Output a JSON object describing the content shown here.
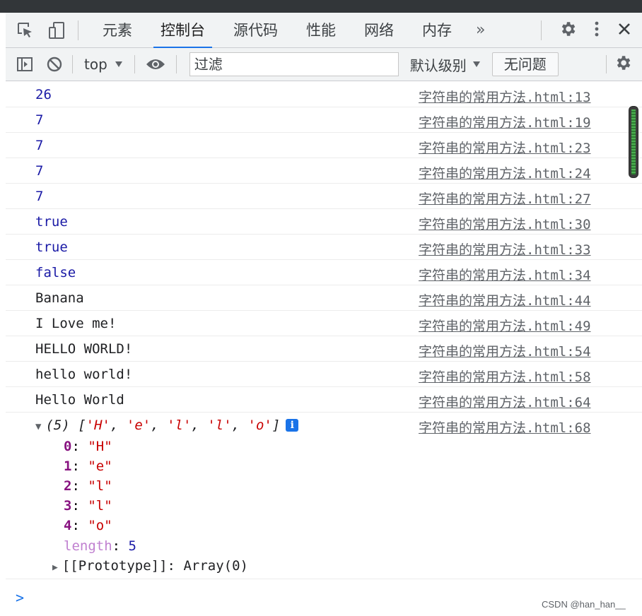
{
  "tabs": [
    {
      "label": "元素"
    },
    {
      "label": "控制台",
      "active": true
    },
    {
      "label": "源代码"
    },
    {
      "label": "性能"
    },
    {
      "label": "网络"
    },
    {
      "label": "内存"
    }
  ],
  "more_tabs_glyph": "»",
  "toolbar": {
    "context": "top",
    "filter_placeholder": "过滤",
    "levels_label": "默认级别",
    "issues_label": "无问题"
  },
  "console": {
    "rows": [
      {
        "text": "26",
        "type": "num",
        "source": "字符串的常用方法.html:13"
      },
      {
        "text": "7",
        "type": "num",
        "source": "字符串的常用方法.html:19"
      },
      {
        "text": "7",
        "type": "num",
        "source": "字符串的常用方法.html:23"
      },
      {
        "text": "7",
        "type": "num",
        "source": "字符串的常用方法.html:24"
      },
      {
        "text": "7",
        "type": "num",
        "source": "字符串的常用方法.html:27"
      },
      {
        "text": "true",
        "type": "bool",
        "source": "字符串的常用方法.html:30"
      },
      {
        "text": "true",
        "type": "bool",
        "source": "字符串的常用方法.html:33"
      },
      {
        "text": "false",
        "type": "bool",
        "source": "字符串的常用方法.html:34"
      },
      {
        "text": "Banana",
        "type": "str",
        "source": "字符串的常用方法.html:44"
      },
      {
        "text": "I Love me!",
        "type": "str",
        "source": "字符串的常用方法.html:49"
      },
      {
        "text": "HELLO WORLD!",
        "type": "str",
        "source": "字符串的常用方法.html:54"
      },
      {
        "text": "hello world!",
        "type": "str",
        "source": "字符串的常用方法.html:58"
      },
      {
        "text": "Hello World",
        "type": "str",
        "source": "字符串的常用方法.html:64"
      }
    ],
    "array_entry": {
      "count": "(5)",
      "items": [
        "'H'",
        "'e'",
        "'l'",
        "'l'",
        "'o'"
      ],
      "source": "字符串的常用方法.html:68",
      "info": "i",
      "props": [
        {
          "key": "0",
          "value": "\"H\""
        },
        {
          "key": "1",
          "value": "\"e\""
        },
        {
          "key": "2",
          "value": "\"l\""
        },
        {
          "key": "3",
          "value": "\"l\""
        },
        {
          "key": "4",
          "value": "\"o\""
        }
      ],
      "length_key": "length",
      "length_value": "5",
      "prototype": "[[Prototype]]",
      "prototype_value": "Array(0)"
    },
    "prompt_glyph": ">"
  },
  "watermark": "CSDN @han_han__"
}
